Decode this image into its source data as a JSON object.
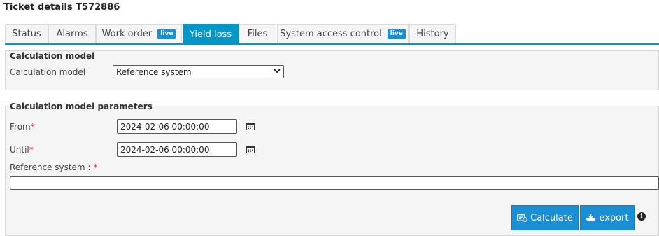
{
  "header": {
    "title": "Ticket details T572886"
  },
  "tabs": [
    {
      "label": "Status",
      "badge": ""
    },
    {
      "label": "Alarms",
      "badge": ""
    },
    {
      "label": "Work order",
      "badge": "live"
    },
    {
      "label": "Yield loss",
      "badge": ""
    },
    {
      "label": "Files",
      "badge": ""
    },
    {
      "label": "System access control",
      "badge": "live"
    },
    {
      "label": "History",
      "badge": ""
    }
  ],
  "active_tab": "Yield loss",
  "calc_model_section": {
    "legend": "Calculation model",
    "label": "Calculation model",
    "selected": "Reference system"
  },
  "params_section": {
    "legend": "Calculation model parameters",
    "from_label": "From",
    "from_value": "2024-02-06 00:00:00",
    "until_label": "Until",
    "until_value": "2024-02-06 00:00:00",
    "reference_label": "Reference system :",
    "reference_value": "",
    "required_mark": "*"
  },
  "actions": {
    "calculate_label": "Calculate",
    "export_label": "export",
    "info_glyph": "i"
  },
  "colors": {
    "accent": "#0096c8",
    "button": "#1a8fd6",
    "required": "#e53935"
  }
}
